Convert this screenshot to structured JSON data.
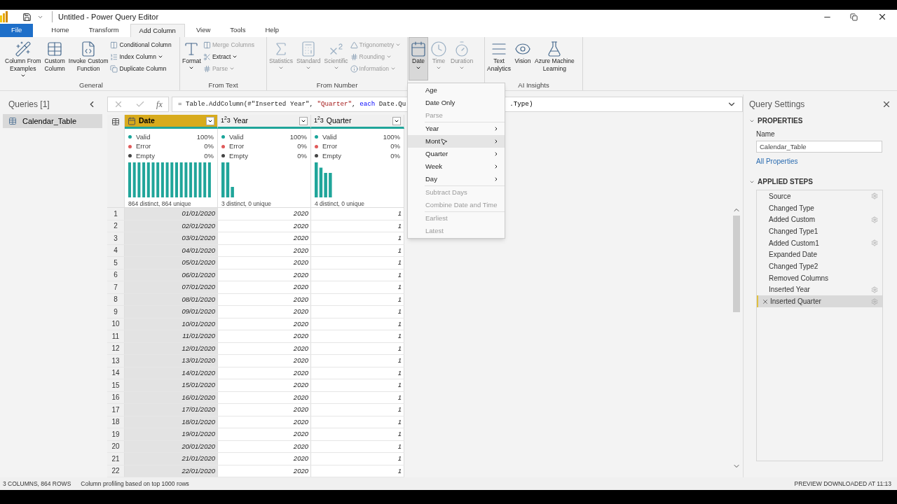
{
  "window": {
    "title": "Untitled - Power Query Editor"
  },
  "tabs": [
    {
      "label": "File",
      "kind": "file",
      "selected": false
    },
    {
      "label": "Home",
      "kind": "tab",
      "selected": false
    },
    {
      "label": "Transform",
      "kind": "tab",
      "selected": false
    },
    {
      "label": "Add Column",
      "kind": "tab",
      "selected": true
    },
    {
      "label": "View",
      "kind": "tab",
      "selected": false
    },
    {
      "label": "Tools",
      "kind": "tab",
      "selected": false
    },
    {
      "label": "Help",
      "kind": "tab",
      "selected": false
    }
  ],
  "ribbon": [
    {
      "label": "General",
      "items": [
        {
          "kind": "large",
          "lines": [
            "Column From",
            "Examples"
          ],
          "dropdown": true,
          "disabled": false,
          "pressed": false
        },
        {
          "kind": "large",
          "lines": [
            "Custom",
            "Column"
          ],
          "dropdown": false,
          "disabled": false,
          "pressed": false
        },
        {
          "kind": "large",
          "lines": [
            "Invoke Custom",
            "Function"
          ],
          "dropdown": false,
          "disabled": false,
          "pressed": false
        },
        {
          "kind": "stack",
          "items": [
            {
              "label": "Conditional Column",
              "dropdown": false,
              "disabled": false
            },
            {
              "label": "Index Column",
              "dropdown": true,
              "disabled": false
            },
            {
              "label": "Duplicate Column",
              "dropdown": false,
              "disabled": false
            }
          ]
        }
      ]
    },
    {
      "label": "From Text",
      "items": [
        {
          "kind": "large",
          "lines": [
            "Format"
          ],
          "dropdown": true,
          "disabled": false,
          "pressed": false
        },
        {
          "kind": "stack",
          "items": [
            {
              "label": "Merge Columns",
              "dropdown": false,
              "disabled": true
            },
            {
              "label": "Extract",
              "dropdown": true,
              "disabled": false
            },
            {
              "label": "Parse",
              "dropdown": true,
              "disabled": true
            }
          ]
        }
      ]
    },
    {
      "label": "From Number",
      "items": [
        {
          "kind": "large",
          "lines": [
            "Statistics"
          ],
          "dropdown": true,
          "disabled": true,
          "pressed": false
        },
        {
          "kind": "large",
          "lines": [
            "Standard"
          ],
          "dropdown": true,
          "disabled": true,
          "pressed": false
        },
        {
          "kind": "large",
          "lines": [
            "Scientific"
          ],
          "dropdown": true,
          "disabled": true,
          "pressed": false
        },
        {
          "kind": "stack",
          "items": [
            {
              "label": "Trigonometry",
              "dropdown": true,
              "disabled": true
            },
            {
              "label": "Rounding",
              "dropdown": true,
              "disabled": true
            },
            {
              "label": "Information",
              "dropdown": true,
              "disabled": true
            }
          ]
        }
      ]
    },
    {
      "items": [
        {
          "kind": "large",
          "lines": [
            "Date"
          ],
          "dropdown": true,
          "disabled": false,
          "pressed": true
        },
        {
          "kind": "large",
          "lines": [
            "Time"
          ],
          "dropdown": true,
          "disabled": true,
          "pressed": false
        },
        {
          "kind": "large",
          "lines": [
            "Duration"
          ],
          "dropdown": true,
          "disabled": true,
          "pressed": false
        }
      ]
    },
    {
      "label": "AI Insights",
      "items": [
        {
          "kind": "large",
          "lines": [
            "Text",
            "Analytics"
          ],
          "dropdown": false,
          "disabled": false,
          "pressed": false
        },
        {
          "kind": "large",
          "lines": [
            "Vision"
          ],
          "dropdown": false,
          "disabled": false,
          "pressed": false
        },
        {
          "kind": "large",
          "lines": [
            "Azure Machine",
            "Learning"
          ],
          "dropdown": false,
          "disabled": false,
          "pressed": false
        }
      ]
    }
  ],
  "date_menu": [
    {
      "label": "Age",
      "kind": "item",
      "disabled": false,
      "selected": false
    },
    {
      "label": "Date Only",
      "kind": "item",
      "disabled": false,
      "selected": false
    },
    {
      "label": "Parse",
      "kind": "item",
      "disabled": true,
      "selected": false
    },
    {
      "kind": "separator"
    },
    {
      "label": "Year",
      "kind": "submenu",
      "disabled": false,
      "selected": false
    },
    {
      "label": "Mont",
      "kind": "submenu",
      "disabled": false,
      "selected": true
    },
    {
      "label": "Quarter",
      "kind": "submenu",
      "disabled": false,
      "selected": false
    },
    {
      "label": "Week",
      "kind": "submenu",
      "disabled": false,
      "selected": false
    },
    {
      "label": "Day",
      "kind": "submenu",
      "disabled": false,
      "selected": false
    },
    {
      "kind": "separator"
    },
    {
      "label": "Subtract Days",
      "kind": "item",
      "disabled": true,
      "selected": false
    },
    {
      "label": "Combine Date and Time",
      "kind": "item",
      "disabled": true,
      "selected": false
    },
    {
      "kind": "separator"
    },
    {
      "label": "Earliest",
      "kind": "item",
      "disabled": true,
      "selected": false
    },
    {
      "label": "Latest",
      "kind": "item",
      "disabled": true,
      "selected": false
    }
  ],
  "queries": {
    "title": "Queries [1]",
    "items": [
      {
        "label": "Calendar_Table",
        "selected": true
      }
    ]
  },
  "formula": {
    "fx": "fx",
    "parts": [
      {
        "text": "= Table.AddColumn(#\"Inserted Year\", ",
        "kind": "plain"
      },
      {
        "text": "\"Quarter\"",
        "kind": "string"
      },
      {
        "text": ", ",
        "kind": "plain"
      },
      {
        "text": "each",
        "kind": "keyword"
      },
      {
        "text": " Date.Qu",
        "kind": "plain"
      }
    ],
    "tail": ".Type)"
  },
  "table": {
    "columns": [
      {
        "name": "Date",
        "kind": "date",
        "selected": true,
        "profile": {
          "stats": [
            {
              "label": "Valid",
              "value": "100%",
              "color": "#1aa59a"
            },
            {
              "label": "Error",
              "value": "0%",
              "color": "#e05a5a"
            },
            {
              "label": "Empty",
              "value": "0%",
              "color": "#444444"
            }
          ],
          "footer": "864 distinct, 864 unique"
        }
      },
      {
        "name": "Year",
        "kind": "number",
        "selected": false,
        "type_label": "1$^{2}$3",
        "profile": {
          "stats": [
            {
              "label": "Valid",
              "value": "100%",
              "color": "#1aa59a"
            },
            {
              "label": "Error",
              "value": "0%",
              "color": "#e05a5a"
            },
            {
              "label": "Empty",
              "value": "0%",
              "color": "#444444"
            }
          ],
          "footer": "3 distinct, 0 unique"
        }
      },
      {
        "name": "Quarter",
        "kind": "number",
        "selected": false,
        "type_label": "1$^{2}$3",
        "profile": {
          "stats": [
            {
              "label": "Valid",
              "value": "100%",
              "color": "#1aa59a"
            },
            {
              "label": "Error",
              "value": "0%",
              "color": "#e05a5a"
            },
            {
              "label": "Empty",
              "value": "0%",
              "color": "#444444"
            }
          ],
          "footer": "4 distinct, 0 unique"
        }
      }
    ],
    "rows": [
      {
        "n": "1",
        "cells": [
          "01/01/2020",
          "2020",
          "1"
        ]
      },
      {
        "n": "2",
        "cells": [
          "02/01/2020",
          "2020",
          "1"
        ]
      },
      {
        "n": "3",
        "cells": [
          "03/01/2020",
          "2020",
          "1"
        ]
      },
      {
        "n": "4",
        "cells": [
          "04/01/2020",
          "2020",
          "1"
        ]
      },
      {
        "n": "5",
        "cells": [
          "05/01/2020",
          "2020",
          "1"
        ]
      },
      {
        "n": "6",
        "cells": [
          "06/01/2020",
          "2020",
          "1"
        ]
      },
      {
        "n": "7",
        "cells": [
          "07/01/2020",
          "2020",
          "1"
        ]
      },
      {
        "n": "8",
        "cells": [
          "08/01/2020",
          "2020",
          "1"
        ]
      },
      {
        "n": "9",
        "cells": [
          "09/01/2020",
          "2020",
          "1"
        ]
      },
      {
        "n": "10",
        "cells": [
          "10/01/2020",
          "2020",
          "1"
        ]
      },
      {
        "n": "11",
        "cells": [
          "11/01/2020",
          "2020",
          "1"
        ]
      },
      {
        "n": "12",
        "cells": [
          "12/01/2020",
          "2020",
          "1"
        ]
      },
      {
        "n": "13",
        "cells": [
          "13/01/2020",
          "2020",
          "1"
        ]
      },
      {
        "n": "14",
        "cells": [
          "14/01/2020",
          "2020",
          "1"
        ]
      },
      {
        "n": "15",
        "cells": [
          "15/01/2020",
          "2020",
          "1"
        ]
      },
      {
        "n": "16",
        "cells": [
          "16/01/2020",
          "2020",
          "1"
        ]
      },
      {
        "n": "17",
        "cells": [
          "17/01/2020",
          "2020",
          "1"
        ]
      },
      {
        "n": "18",
        "cells": [
          "18/01/2020",
          "2020",
          "1"
        ]
      },
      {
        "n": "19",
        "cells": [
          "19/01/2020",
          "2020",
          "1"
        ]
      },
      {
        "n": "20",
        "cells": [
          "20/01/2020",
          "2020",
          "1"
        ]
      },
      {
        "n": "21",
        "cells": [
          "21/01/2020",
          "2020",
          "1"
        ]
      },
      {
        "n": "22",
        "cells": [
          "22/01/2020",
          "2020",
          "1"
        ]
      }
    ]
  },
  "settings": {
    "title": "Query Settings",
    "properties_heading": "PROPERTIES",
    "name_label": "Name",
    "name_value": "Calendar_Table",
    "all_properties": "All Properties",
    "steps_heading": "APPLIED STEPS",
    "steps": [
      {
        "label": "Source",
        "gear": true,
        "selected": false
      },
      {
        "label": "Changed Type",
        "gear": false,
        "selected": false
      },
      {
        "label": "Added Custom",
        "gear": true,
        "selected": false
      },
      {
        "label": "Changed Type1",
        "gear": false,
        "selected": false
      },
      {
        "label": "Added Custom1",
        "gear": true,
        "selected": false
      },
      {
        "label": "Expanded Date",
        "gear": false,
        "selected": false
      },
      {
        "label": "Changed Type2",
        "gear": false,
        "selected": false
      },
      {
        "label": "Removed Columns",
        "gear": false,
        "selected": false
      },
      {
        "label": "Inserted Year",
        "gear": true,
        "selected": false
      },
      {
        "label": "Inserted Quarter",
        "gear": true,
        "selected": true
      }
    ]
  },
  "status_bar": {
    "left": "3 COLUMNS, 864 ROWS",
    "middle": "Column profiling based on top 1000 rows",
    "right": "PREVIEW DOWNLOADED AT 11:13"
  }
}
